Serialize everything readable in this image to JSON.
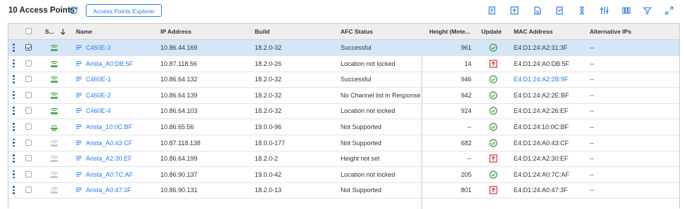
{
  "header": {
    "title": "10 Access Points",
    "explorer_button": "Access Points Explorer"
  },
  "toolbar": [
    "export-icon",
    "upload-icon",
    "document-icon",
    "edit-document-icon",
    "hourglass-icon",
    "column-settings-icon",
    "columns-icon",
    "filter-icon",
    "expand-icon"
  ],
  "columns": {
    "status": "S...",
    "name": "Name",
    "ip": "IP Address",
    "build": "Build",
    "afc": "AFC Status",
    "height": "Height (Mete...",
    "update": "Update",
    "mac": "MAC Address",
    "altips": "Alternative IPs"
  },
  "rows": [
    {
      "name": "C460E-3",
      "ip": "10.86.44.169",
      "build": "18.2.0-32",
      "afc": "Successful",
      "height": "961",
      "update": "ok",
      "mac": "E4:D1:24:A2:31:3F",
      "mac_link": false,
      "alt": "--",
      "ap_color": "#4caf50",
      "ap_style": "full",
      "selected": true
    },
    {
      "name": "Arista_A0:DB:5F",
      "ip": "10.87.118.56",
      "build": "18.2.0-26",
      "afc": "Location not locked",
      "height": "14",
      "update": "upgrade",
      "mac": "E4:D1:24:A0:DB:5F",
      "mac_link": false,
      "alt": "--",
      "ap_color": "#4caf50",
      "ap_style": "full",
      "selected": false
    },
    {
      "name": "C460E-1",
      "ip": "10.86.64.132",
      "build": "18.2.0-32",
      "afc": "Successful",
      "height": "946",
      "update": "ok",
      "mac": "E4:D1:24:A2:2B:9F",
      "mac_link": true,
      "alt": "--",
      "ap_color": "#4caf50",
      "ap_style": "full",
      "selected": false
    },
    {
      "name": "C460E-2",
      "ip": "10.86.64.139",
      "build": "18.2.0-32",
      "afc": "No Channel list in Response",
      "height": "942",
      "update": "ok",
      "mac": "E4:D1:24:A2:2E:BF",
      "mac_link": false,
      "alt": "--",
      "ap_color": "#4caf50",
      "ap_style": "full",
      "selected": false
    },
    {
      "name": "C460E-4",
      "ip": "10.86.64.103",
      "build": "18.2.0-32",
      "afc": "Location not locked",
      "height": "924",
      "update": "ok",
      "mac": "E4:D1:24:A2:26:EF",
      "mac_link": false,
      "alt": "--",
      "ap_color": "#4caf50",
      "ap_style": "full",
      "selected": false
    },
    {
      "name": "Arista_10:0C:BF",
      "ip": "10.86.65.56",
      "build": "19.0.0-96",
      "afc": "Not Supported",
      "height": "--",
      "update": "ok",
      "mac": "E4:D1:24:10:0C:BF",
      "mac_link": false,
      "alt": "--",
      "ap_color": "#4caf50",
      "ap_style": "flat",
      "selected": false
    },
    {
      "name": "Arista_A0:43:CF",
      "ip": "10.87.118.138",
      "build": "18.0.0-177",
      "afc": "Not Supported",
      "height": "682",
      "update": "ok",
      "mac": "E4:D1:24:A0:43:CF",
      "mac_link": false,
      "alt": "--",
      "ap_color": "#c8c8c8",
      "ap_style": "full",
      "selected": false
    },
    {
      "name": "Arista_A2:30:EF",
      "ip": "10.86.64.199",
      "build": "18.2.0-2",
      "afc": "Height not set",
      "height": "--",
      "update": "upgrade",
      "mac": "E4:D1:24:A2:30:EF",
      "mac_link": false,
      "alt": "--",
      "ap_color": "#c8c8c8",
      "ap_style": "full",
      "selected": false
    },
    {
      "name": "Arista_A0:7C:AF",
      "ip": "10.86.90.137",
      "build": "19.0.0-42",
      "afc": "Location not locked",
      "height": "205",
      "update": "ok",
      "mac": "E4:D1:24:A0:7C:AF",
      "mac_link": false,
      "alt": "--",
      "ap_color": "#c8c8c8",
      "ap_style": "full",
      "selected": false
    },
    {
      "name": "Arista_A0:47:3F",
      "ip": "10.86.90.131",
      "build": "18.2.0-13",
      "afc": "Not Supported",
      "height": "801",
      "update": "upgrade",
      "mac": "E4:D1:24:A0:47:3F",
      "mac_link": false,
      "alt": "--",
      "ap_color": "#c8c8c8",
      "ap_style": "full",
      "selected": false
    }
  ],
  "colors": {
    "accent": "#2a7de1",
    "ok": "#3a9a3a",
    "upgrade": "#d9342b",
    "selected_row": "#d6e6f9"
  }
}
